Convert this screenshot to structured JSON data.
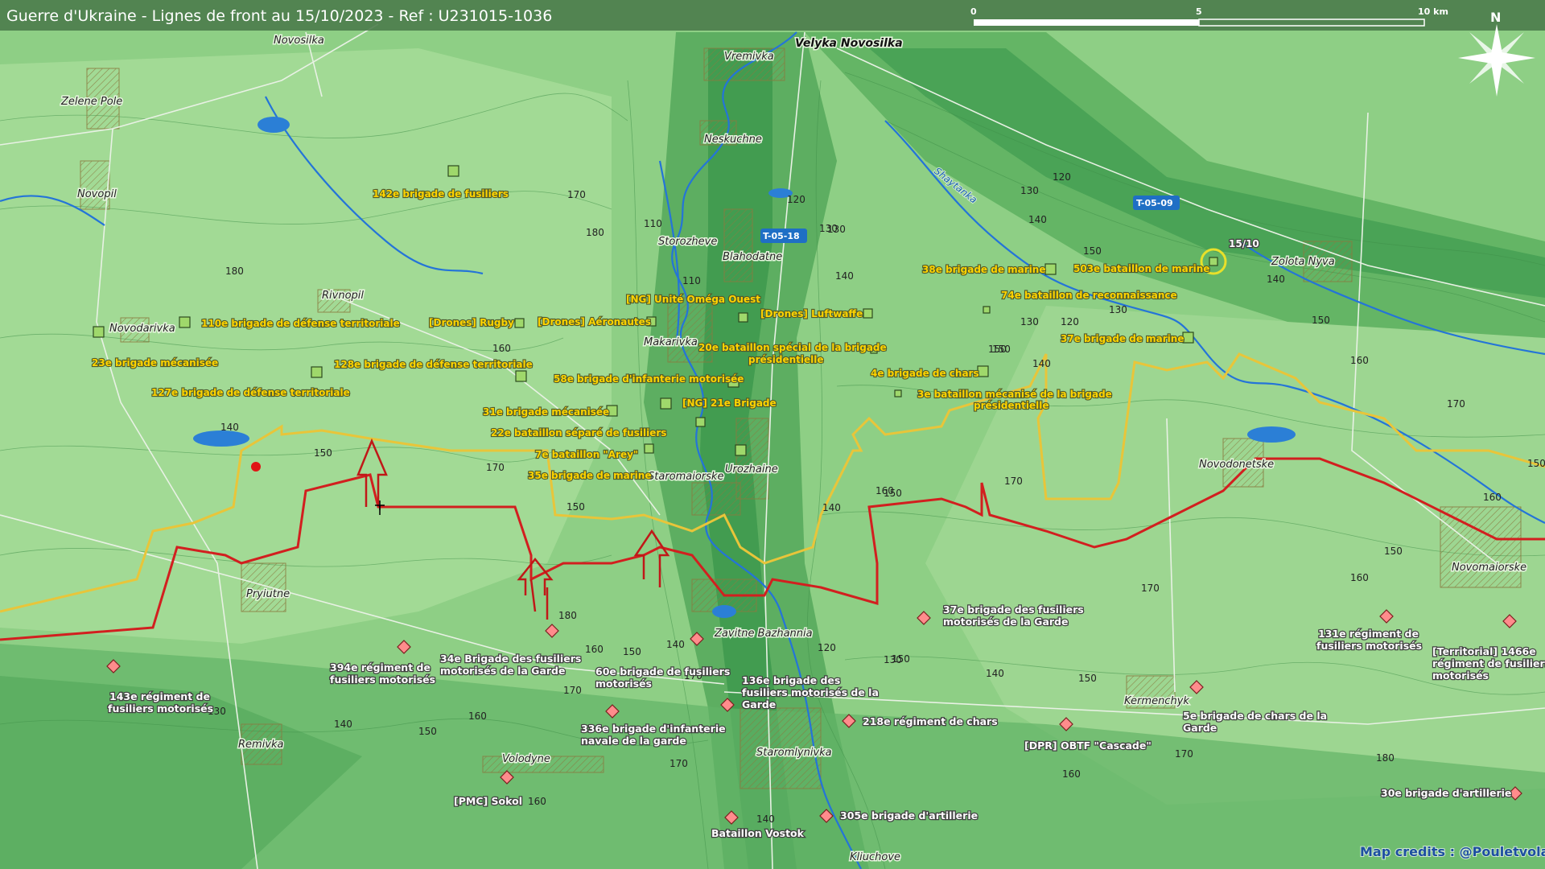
{
  "title": "Guerre d'Ukraine - Lignes de front au 15/10/2023 - Ref : U231015-1036",
  "credits": "Map credits : @Pouletvolant3",
  "north_label": "N",
  "scale": {
    "labels": [
      "0",
      "5",
      "10 km"
    ]
  },
  "date_marker": "15/10",
  "colors": {
    "front_ru": "#d21f1f",
    "front_ua": "#e8c53a",
    "river": "#2474d8",
    "ua_unit": "#9fd86b",
    "ru_unit": "#ff8c8c",
    "road_tag": "#1f6fc5"
  },
  "roads": [
    {
      "id": "t0518",
      "label": "T-05-18"
    },
    {
      "id": "t0509",
      "label": "T-05-09"
    }
  ],
  "rivers": [
    {
      "label": "Shaytanka"
    }
  ],
  "places": [
    {
      "name": "Velyka Novosilka",
      "bold": true
    },
    {
      "name": "Novosilka"
    },
    {
      "name": "Vremivka"
    },
    {
      "name": "Zelene Pole"
    },
    {
      "name": "Neskuchne"
    },
    {
      "name": "Novopil"
    },
    {
      "name": "Storozheve"
    },
    {
      "name": "Blahodatne"
    },
    {
      "name": "Zolota Nyva"
    },
    {
      "name": "Rivnopil"
    },
    {
      "name": "Novodarivka"
    },
    {
      "name": "Makarivka"
    },
    {
      "name": "Urozhaine"
    },
    {
      "name": "Staromaiorske"
    },
    {
      "name": "Novodonetske"
    },
    {
      "name": "Novomaiorske"
    },
    {
      "name": "Pryiutne"
    },
    {
      "name": "Zavitne Bazhannia"
    },
    {
      "name": "Kermenchyk"
    },
    {
      "name": "Staromlynivka"
    },
    {
      "name": "Remivka"
    },
    {
      "name": "Volodyne"
    },
    {
      "name": "Kliuchove"
    }
  ],
  "ua_units": [
    "142e brigade de fusiliers",
    "110e brigade de défense territoriale",
    "23e brigade mécanisée",
    "128e brigade de défense territoriale",
    "127e brigade de défense territoriale",
    "[Drones] Rugby",
    "[Drones] Aéronautes",
    "[NG] Unité Oméga Ouest",
    "[Drones] Luftwaffe",
    "58e brigade d'infanterie motorisée",
    "31e brigade mécanisée",
    "[NG] 21e Brigade",
    "22e bataillon séparé de fusiliers",
    "7e bataillon \"Arey\"",
    "35e brigade de marine",
    "20e bataillon spécial de la brigade",
    "présidentielle",
    "38e brigade de marine",
    "503e bataillon de marine",
    "74e bataillon de reconnaissance",
    "37e brigade de marine",
    "4e brigade de chars",
    "3e bataillon mécanisé de la brigade",
    "présidentielle"
  ],
  "ru_units": [
    "37e brigade des fusiliers",
    "motorisés de la Garde",
    "131e régiment de",
    "fusiliers motorisés",
    "[Territorial] 1466e",
    "régiment de fusiliers",
    "motorisés",
    "143e régiment de",
    "fusiliers motorisés",
    "394e régiment de",
    "fusiliers motorisés",
    "34e Brigade des fusiliers",
    "motorisés de la Garde",
    "60e brigade de fusiliers",
    "motorisés",
    "136e brigade des",
    "fusiliers motorisés de la",
    "Garde",
    "336e brigade d'infanterie",
    "navale de la garde",
    "218e régiment de chars",
    "[DPR] OBTF \"Cascade\"",
    "5e brigade de chars de la",
    "Garde",
    "[PMC] Sokol",
    "305e brigade d'artillerie",
    "Bataillon Vostok",
    "30e brigade d'artillerie"
  ],
  "elevations": [
    "170",
    "180",
    "180",
    "110",
    "120",
    "130",
    "110",
    "120",
    "130",
    "140",
    "130",
    "140",
    "150",
    "140",
    "150",
    "130",
    "120",
    "130",
    "150",
    "170",
    "140",
    "160",
    "150",
    "160",
    "140",
    "150",
    "170",
    "150",
    "140",
    "160",
    "170",
    "150",
    "160",
    "150",
    "160",
    "170",
    "180",
    "140",
    "160",
    "150",
    "130",
    "140",
    "150",
    "160",
    "170",
    "120",
    "140",
    "150",
    "170",
    "180",
    "160",
    "140",
    "130",
    "150",
    "170",
    "160",
    "170",
    "150"
  ]
}
